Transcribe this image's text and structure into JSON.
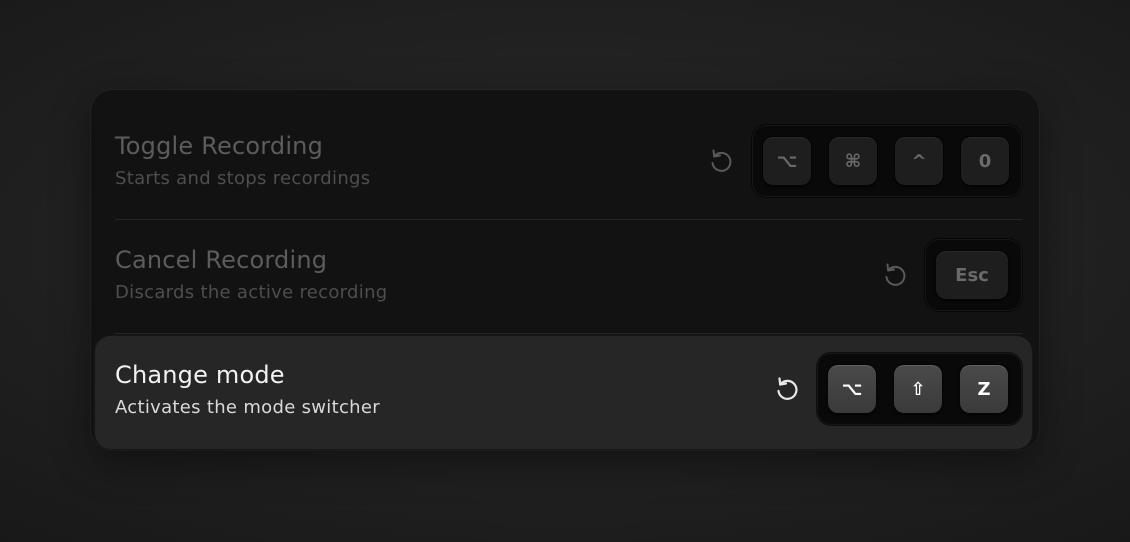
{
  "shortcuts": [
    {
      "title": "Toggle Recording",
      "description": "Starts and stops recordings",
      "state": "dimmed",
      "reset_icon": "reset-icon",
      "keys": [
        "⌥",
        "⌘",
        "^",
        "0"
      ]
    },
    {
      "title": "Cancel Recording",
      "description": "Discards the active recording",
      "state": "dimmed",
      "reset_icon": "reset-icon",
      "keys": [
        "Esc"
      ]
    },
    {
      "title": "Change mode",
      "description": "Activates the mode switcher",
      "state": "active",
      "reset_icon": "reset-icon",
      "keys": [
        "⌥",
        "⇧",
        "Z"
      ]
    }
  ],
  "colors": {
    "panel_background": "#121212",
    "active_row_background": "#262626",
    "dim_text": "#5c5c5c",
    "active_text": "#f2f2f2"
  }
}
